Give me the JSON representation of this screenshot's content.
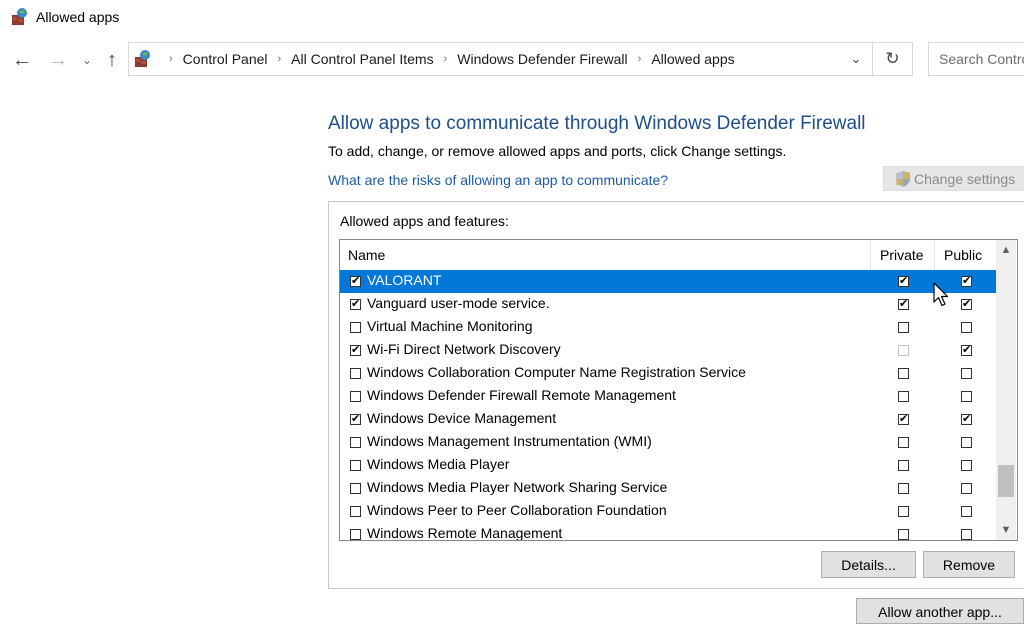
{
  "window": {
    "title": "Allowed apps"
  },
  "nav": {
    "back_icon": "←",
    "forward_icon": "→",
    "recent_icon": "⌄",
    "up_icon": "↑"
  },
  "address": {
    "breadcrumb": [
      "Control Panel",
      "All Control Panel Items",
      "Windows Defender Firewall",
      "Allowed apps"
    ],
    "separator": "›",
    "dropdown_icon": "⌄",
    "refresh_icon": "↻"
  },
  "search": {
    "placeholder": "Search Contro"
  },
  "main": {
    "heading": "Allow apps to communicate through Windows Defender Firewall",
    "instructions": "To add, change, or remove allowed apps and ports, click Change settings.",
    "risk_link": "What are the risks of allowing an app to communicate?",
    "change_settings_label": "Change settings"
  },
  "list": {
    "group_label": "Allowed apps and features:",
    "columns": {
      "name": "Name",
      "private": "Private",
      "public": "Public"
    },
    "rows": [
      {
        "name": "VALORANT",
        "enabled": true,
        "private": true,
        "public": true,
        "selected": true
      },
      {
        "name": "Vanguard user-mode service.",
        "enabled": true,
        "private": true,
        "public": true
      },
      {
        "name": "Virtual Machine Monitoring",
        "enabled": false,
        "private": false,
        "public": false
      },
      {
        "name": "Wi-Fi Direct Network Discovery",
        "enabled": true,
        "private": false,
        "public": true,
        "private_disabled": true
      },
      {
        "name": "Windows Collaboration Computer Name Registration Service",
        "enabled": false,
        "private": false,
        "public": false
      },
      {
        "name": "Windows Defender Firewall Remote Management",
        "enabled": false,
        "private": false,
        "public": false
      },
      {
        "name": "Windows Device Management",
        "enabled": true,
        "private": true,
        "public": true
      },
      {
        "name": "Windows Management Instrumentation (WMI)",
        "enabled": false,
        "private": false,
        "public": false
      },
      {
        "name": "Windows Media Player",
        "enabled": false,
        "private": false,
        "public": false
      },
      {
        "name": "Windows Media Player Network Sharing Service",
        "enabled": false,
        "private": false,
        "public": false
      },
      {
        "name": "Windows Peer to Peer Collaboration Foundation",
        "enabled": false,
        "private": false,
        "public": false
      },
      {
        "name": "Windows Remote Management",
        "enabled": false,
        "private": false,
        "public": false
      }
    ],
    "scroll_up_icon": "▲",
    "scroll_down_icon": "▼"
  },
  "buttons": {
    "details": "Details...",
    "remove": "Remove",
    "allow_another": "Allow another app..."
  },
  "colors": {
    "heading": "#1e4e8c",
    "link": "#1e5aa6",
    "selection": "#0078d7"
  },
  "icons": {
    "window": "control-panel-icon",
    "shield": "uac-shield-icon",
    "cursor": "mouse-pointer-icon"
  }
}
